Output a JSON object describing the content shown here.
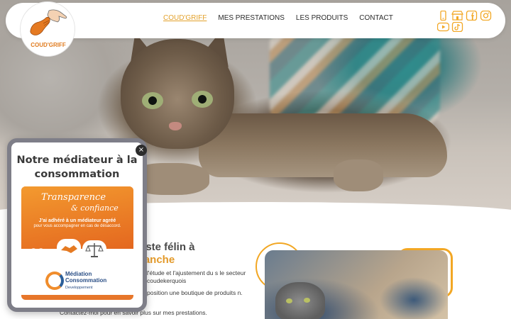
{
  "brand": {
    "logo_text": "COUD'GRIFF"
  },
  "nav": {
    "items": [
      {
        "label": "COUD'GRIFF",
        "active": true
      },
      {
        "label": "MES PRESTATIONS",
        "active": false
      },
      {
        "label": "LES PRODUITS",
        "active": false
      },
      {
        "label": "CONTACT",
        "active": false
      }
    ]
  },
  "socials": [
    "phone-icon",
    "store-icon",
    "facebook-icon",
    "instagram-icon",
    "youtube-icon",
    "tiktok-icon"
  ],
  "colors": {
    "accent": "#e3a12b",
    "orange": "#f2a724",
    "text": "#2b2b2b",
    "popup_border": "#7e7e88"
  },
  "popup": {
    "title": "Notre médiateur à la consommation",
    "close_symbol": "×",
    "card": {
      "headline_1": "Transparence",
      "headline_2": "& confiance",
      "line_1": "J'ai adhéré à un médiateur agréé",
      "line_2": "pour vous accompagner en cas de désaccord.",
      "brand_name_1": "Médiation",
      "brand_name_2": "Consommation",
      "brand_sub": "Developpement"
    }
  },
  "main": {
    "heading_1": "liste félin à",
    "heading_2": "ranche",
    "para_1": "l'étude et l'ajustement du s le secteur coudekerquois",
    "para_2": "position une boutique de produits n.",
    "para_3": "Contactez-moi pour en savoir plus sur mes prestations."
  }
}
